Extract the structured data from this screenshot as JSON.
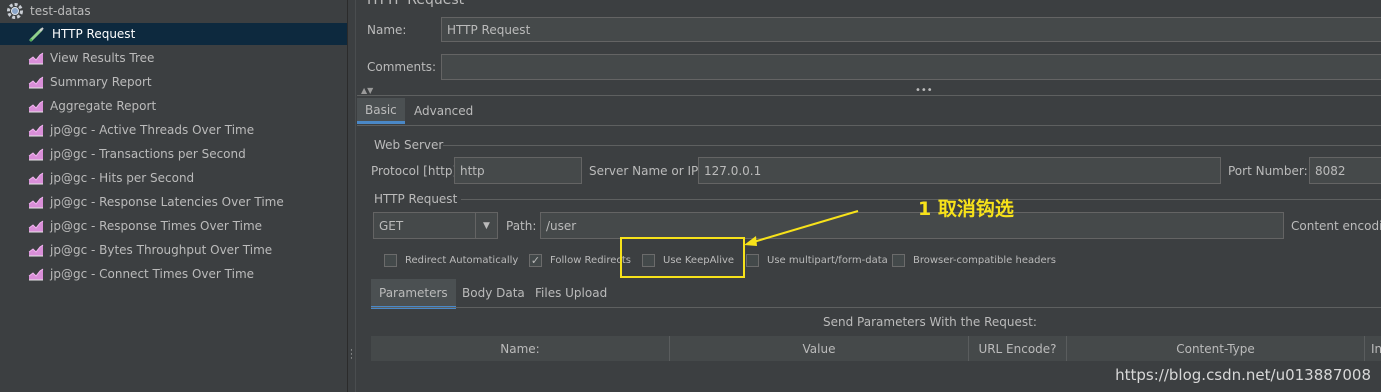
{
  "tree": {
    "root_label": "test-datas",
    "items": [
      {
        "label": "HTTP Request",
        "selected": true,
        "icon": "pipette-icon"
      },
      {
        "label": "View Results Tree",
        "icon": "chart-icon"
      },
      {
        "label": "Summary Report",
        "icon": "chart-icon"
      },
      {
        "label": "Aggregate Report",
        "icon": "chart-icon"
      },
      {
        "label": "jp@gc - Active Threads Over Time",
        "icon": "chart-icon"
      },
      {
        "label": "jp@gc - Transactions per Second",
        "icon": "chart-icon"
      },
      {
        "label": "jp@gc - Hits per Second",
        "icon": "chart-icon"
      },
      {
        "label": "jp@gc - Response Latencies Over Time",
        "icon": "chart-icon"
      },
      {
        "label": "jp@gc - Response Times Over Time",
        "icon": "chart-icon"
      },
      {
        "label": "jp@gc - Bytes Throughput Over Time",
        "icon": "chart-icon"
      },
      {
        "label": "jp@gc - Connect Times Over Time",
        "icon": "chart-icon"
      }
    ]
  },
  "form": {
    "header_title": "HTTP Request",
    "name_label": "Name:",
    "name_value": "HTTP Request",
    "comments_label": "Comments:",
    "comments_value": "",
    "tabs": [
      "Basic",
      "Advanced"
    ],
    "web_server": {
      "title": "Web Server",
      "protocol_label": "Protocol [http]:",
      "protocol_value": "http",
      "server_label": "Server Name or IP:",
      "server_value": "127.0.0.1",
      "port_label": "Port Number:",
      "port_value": "8082"
    },
    "http_request": {
      "title": "HTTP Request",
      "method_value": "GET",
      "path_label": "Path:",
      "path_value": "/user",
      "content_encoding_label": "Content encodin"
    },
    "checkboxes": [
      {
        "label": "Redirect Automatically",
        "checked": false
      },
      {
        "label": "Follow Redirects",
        "checked": true
      },
      {
        "label": "Use KeepAlive",
        "checked": false
      },
      {
        "label": "Use multipart/form-data",
        "checked": false
      },
      {
        "label": "Browser-compatible headers",
        "checked": false
      }
    ],
    "sub_tabs": [
      "Parameters",
      "Body Data",
      "Files Upload"
    ],
    "params_caption": "Send Parameters With the Request:",
    "table_headers": [
      "Name:",
      "Value",
      "URL Encode?",
      "Content-Type",
      "In"
    ]
  },
  "annotation": {
    "text": "1 取消钩选",
    "color": "#f7e21a"
  },
  "watermark": "https://blog.csdn.net/u013887008",
  "colors": {
    "background": "#3c3f41",
    "field_bg": "#45494a",
    "selection": "#0d293e",
    "accent": "#4a88c7"
  }
}
